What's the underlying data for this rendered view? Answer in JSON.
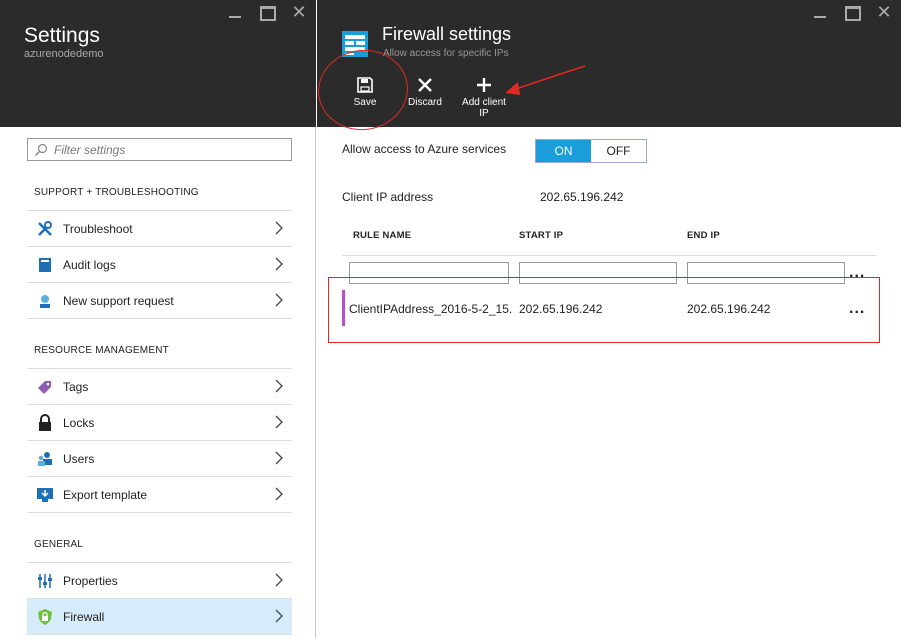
{
  "left_blade": {
    "title": "Settings",
    "subtitle": "azurenodedemo",
    "filter_placeholder": "Filter settings",
    "sections": {
      "support": {
        "label": "SUPPORT + TROUBLESHOOTING",
        "items": [
          {
            "label": "Troubleshoot",
            "icon": "wrench-icon"
          },
          {
            "label": "Audit logs",
            "icon": "log-book-icon"
          },
          {
            "label": "New support request",
            "icon": "support-person-icon"
          }
        ]
      },
      "resource": {
        "label": "RESOURCE MANAGEMENT",
        "items": [
          {
            "label": "Tags",
            "icon": "tag-icon"
          },
          {
            "label": "Locks",
            "icon": "lock-icon"
          },
          {
            "label": "Users",
            "icon": "users-icon"
          },
          {
            "label": "Export template",
            "icon": "export-template-icon"
          }
        ]
      },
      "general": {
        "label": "GENERAL",
        "items": [
          {
            "label": "Properties",
            "icon": "properties-sliders-icon"
          },
          {
            "label": "Firewall",
            "icon": "shield-icon",
            "active": true
          }
        ]
      }
    }
  },
  "right_blade": {
    "title": "Firewall settings",
    "subtitle": "Allow access for specific IPs",
    "commands": {
      "save": "Save",
      "discard": "Discard",
      "add_client_ip_line1": "Add client",
      "add_client_ip_line2": "IP"
    },
    "allow_azure": {
      "label": "Allow access to Azure services",
      "on": "ON",
      "off": "OFF",
      "selected": "ON"
    },
    "client_ip": {
      "label": "Client IP address",
      "value": "202.65.196.242"
    },
    "table": {
      "headers": [
        "RULE NAME",
        "START IP",
        "END IP"
      ],
      "new_row": {
        "rule_name": "",
        "start_ip": "",
        "end_ip": ""
      },
      "rows": [
        {
          "rule_name": "ClientIPAddress_2016-5-2_15..",
          "start_ip": "202.65.196.242",
          "end_ip": "202.65.196.242"
        }
      ],
      "more_label": "..."
    }
  },
  "colors": {
    "header_bg": "#2b2b2b",
    "accent": "#1a9edb",
    "active_item_bg": "#d6ecfa",
    "rule_marker": "#b84fd1",
    "annotation": "#e02a21"
  }
}
